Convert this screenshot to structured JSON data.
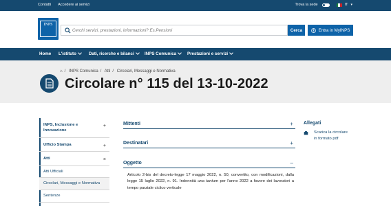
{
  "topbar": {
    "links": [
      "Contatti",
      "Accedere ai servizi"
    ],
    "theme_label": "Trova la sede",
    "language": "IT"
  },
  "header": {
    "logo_text": "INPS",
    "logo_subtext": "Istituto Nazionale Previdenza Sociale",
    "search_placeholder": "Cerchi servizi, prestazioni, informazioni? Es.Pensioni",
    "search_button": "Cerca",
    "login_button": "Entra in MyINPS"
  },
  "nav": {
    "items": [
      "Home",
      "L'istituto",
      "Dati, ricerche e bilanci",
      "INPS Comunica",
      "Prestazioni e servizi"
    ]
  },
  "breadcrumb": [
    "INPS Comunica",
    "Atti",
    "Circolari, Messaggi e Normativa"
  ],
  "page_title": "Circolare n° 115 del 13-10-2022",
  "sidebar": {
    "items": [
      {
        "label": "INPS, Inclusione e Innovazione",
        "symbol": "+"
      },
      {
        "label": "Ufficio Stampa",
        "symbol": "+"
      },
      {
        "label": "Atti",
        "symbol": "×"
      },
      {
        "label": "Atti Ufficiali"
      },
      {
        "label": "Circolari, Messaggi e Normativa"
      },
      {
        "label": "Sentenze"
      }
    ]
  },
  "accordion": {
    "mittenti": {
      "label": "Mittenti",
      "symbol": "+"
    },
    "destinatari": {
      "label": "Destinatari",
      "symbol": "+"
    },
    "oggetto": {
      "label": "Oggetto",
      "symbol": "–",
      "text_before": "Articolo 2-bis del decreto-legge 17 maggio 2022, n. 50, convertito, con modificazioni, dalla legge 15 luglio 2022, n. 91. Indennità ",
      "text_italic": "una tantum",
      "text_after": " per l'anno 2022 a favore dei lavoratori a tempo parziale ciclico verticale"
    }
  },
  "allegati": {
    "title": "Allegati",
    "file_label": "Scarica la circolare in formato pdf"
  },
  "colors": {
    "primary": "#15496f",
    "brand_blue": "#0e63a8",
    "hero_bg": "#eeeeee"
  }
}
